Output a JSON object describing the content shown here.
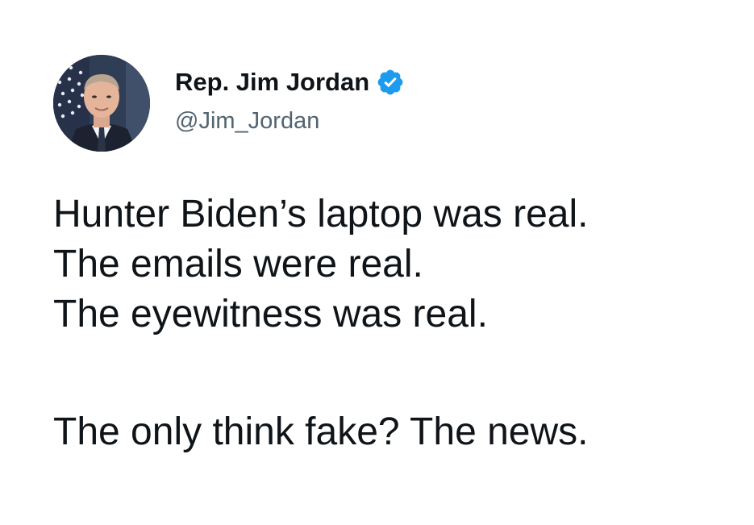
{
  "tweet": {
    "author": {
      "display_name": "Rep. Jim Jordan",
      "handle": "@Jim_Jordan",
      "verified": true,
      "verified_badge_color": "#1d9bf0",
      "avatar_icon": "profile-photo"
    },
    "lines": [
      "Hunter Biden’s laptop was real.",
      "The emails were real.",
      "The eyewitness was real.",
      "The only think fake? The news."
    ]
  },
  "colors": {
    "text_primary": "#0f1419",
    "text_secondary": "#536471",
    "background": "#ffffff"
  }
}
